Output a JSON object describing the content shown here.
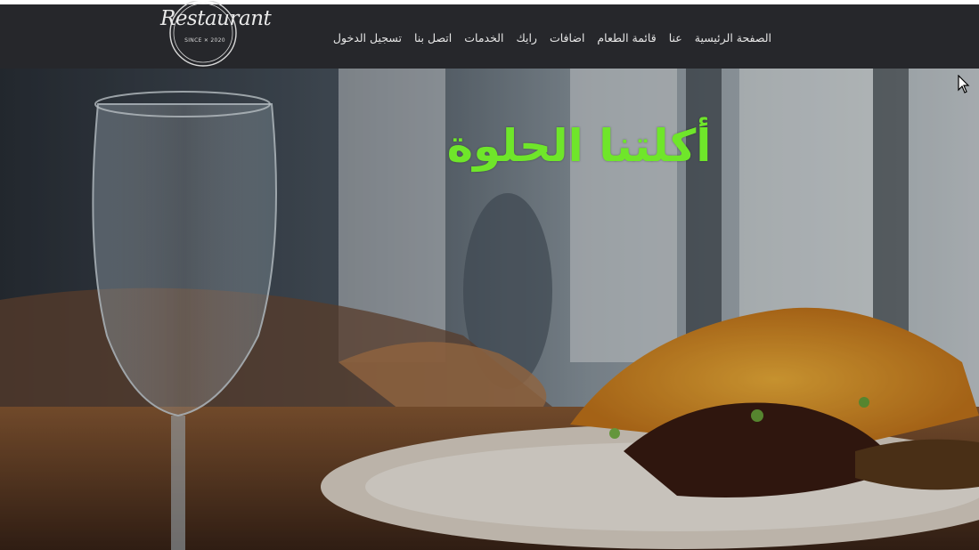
{
  "logo": {
    "word": "Restaurant",
    "since": "SINCE ✕ 2020"
  },
  "nav": {
    "items": [
      {
        "label": "الصفحة الرئيسية"
      },
      {
        "label": "عنا"
      },
      {
        "label": "قائمة الطعام"
      },
      {
        "label": "اضافات"
      },
      {
        "label": "رايك"
      },
      {
        "label": "الخدمات"
      },
      {
        "label": "اتصل بنا"
      },
      {
        "label": "تسجيل الدخول"
      }
    ]
  },
  "hero": {
    "title": "أكلتنا الحلوة"
  },
  "colors": {
    "navbar": "#26272b",
    "title": "#6fe62a",
    "nav_text": "#e6e6e6"
  }
}
